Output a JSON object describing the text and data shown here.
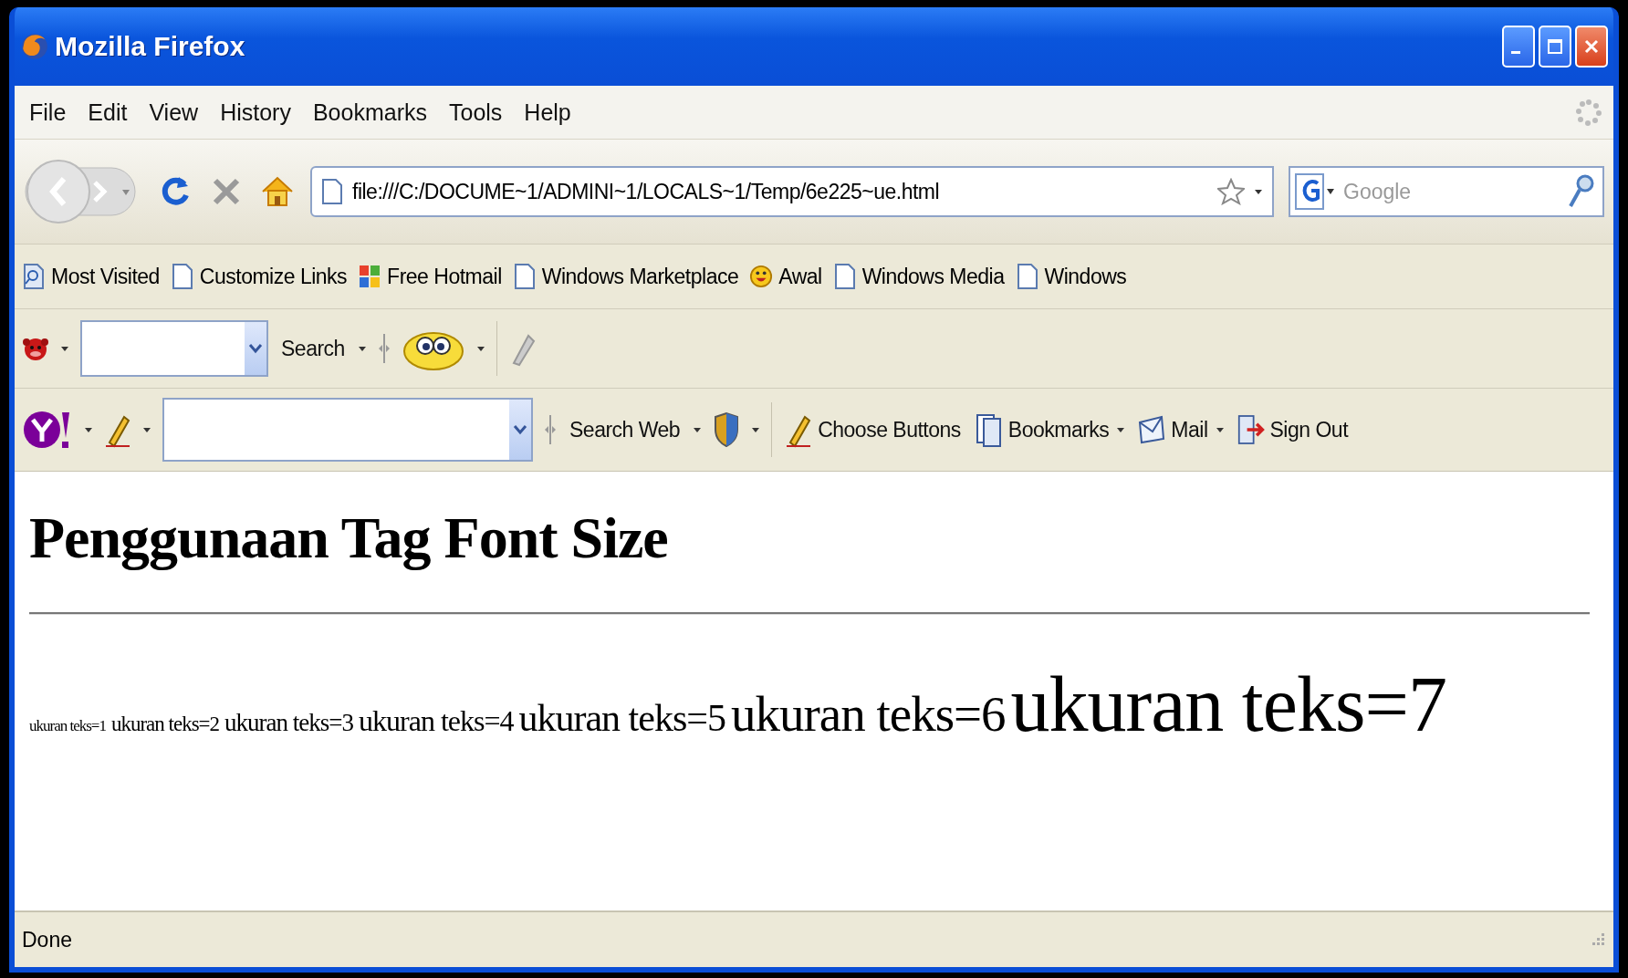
{
  "window": {
    "title": "Mozilla Firefox"
  },
  "menu": [
    "File",
    "Edit",
    "View",
    "History",
    "Bookmarks",
    "Tools",
    "Help"
  ],
  "navigation": {
    "address": "file:///C:/DOCUME~1/ADMINI~1/LOCALS~1/Temp/6e225~ue.html"
  },
  "search": {
    "placeholder": "Google"
  },
  "bookmarks": [
    {
      "label": "Most Visited",
      "kind": "visited"
    },
    {
      "label": "Customize Links",
      "kind": "page"
    },
    {
      "label": "Free Hotmail",
      "kind": "windows"
    },
    {
      "label": "Windows Marketplace",
      "kind": "page"
    },
    {
      "label": "Awal",
      "kind": "smiley"
    },
    {
      "label": "Windows Media",
      "kind": "page"
    },
    {
      "label": "Windows",
      "kind": "page"
    }
  ],
  "search_toolbar": {
    "button": "Search"
  },
  "yahoo_toolbar": {
    "search_button": "Search Web",
    "buttons": [
      {
        "label": "Choose Buttons",
        "kind": "pencil",
        "dropdown": false
      },
      {
        "label": "Bookmarks",
        "kind": "bookmarks",
        "dropdown": true
      },
      {
        "label": "Mail",
        "kind": "mail",
        "dropdown": true
      },
      {
        "label": "Sign Out",
        "kind": "signout",
        "dropdown": false
      }
    ]
  },
  "page": {
    "heading": "Penggunaan Tag Font Size",
    "samples": [
      "ukuran teks=1",
      "ukuran teks=2",
      "ukuran teks=3",
      "ukuran teks=4",
      "ukuran teks=5",
      "ukuran teks=6",
      "ukuran teks=7"
    ]
  },
  "status_bar": {
    "text": "Done"
  }
}
